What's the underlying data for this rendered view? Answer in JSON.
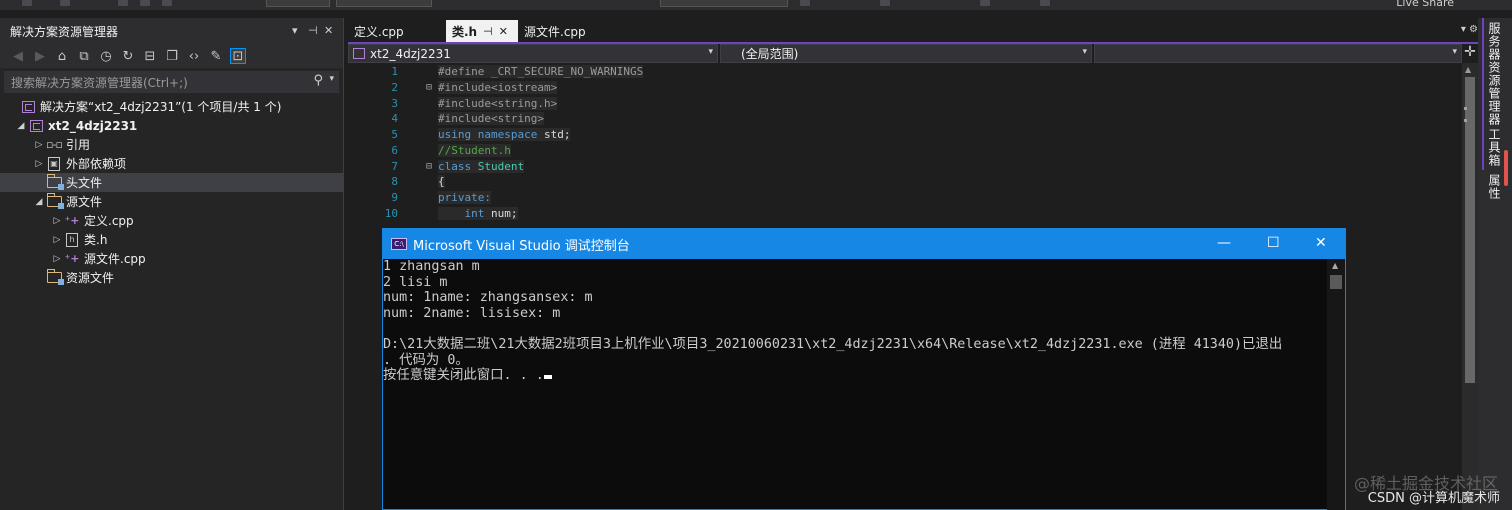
{
  "topbar": {
    "live_share": "Live Share"
  },
  "solution_explorer": {
    "title": "解决方案资源管理器",
    "controls": {
      "dropdown": "▾",
      "pin": "⊣",
      "close": "✕"
    },
    "search_placeholder": "搜索解决方案资源管理器(Ctrl+;)",
    "tree": [
      {
        "label": "解决方案“xt2_4dzj2231”(1 个项目/共 1 个)",
        "icon": "solution-icon",
        "indent": 0,
        "arrow": ""
      },
      {
        "label": "xt2_4dzj2231",
        "icon": "project-icon",
        "indent": 1,
        "arrow": "◢",
        "bold": true
      },
      {
        "label": "引用",
        "icon": "references-icon",
        "indent": 2,
        "arrow": "▷"
      },
      {
        "label": "外部依赖项",
        "icon": "external-deps-icon",
        "indent": 2,
        "arrow": "▷"
      },
      {
        "label": "头文件",
        "icon": "folder-icon",
        "indent": 2,
        "arrow": "",
        "selected": true
      },
      {
        "label": "源文件",
        "icon": "folder-icon",
        "indent": 2,
        "arrow": "◢"
      },
      {
        "label": "定义.cpp",
        "icon": "cpp-file-icon",
        "indent": 3,
        "arrow": "▷"
      },
      {
        "label": "类.h",
        "icon": "header-file-icon",
        "indent": 3,
        "arrow": "▷"
      },
      {
        "label": "源文件.cpp",
        "icon": "cpp-file-icon",
        "indent": 3,
        "arrow": "▷"
      },
      {
        "label": "资源文件",
        "icon": "folder-icon",
        "indent": 2,
        "arrow": ""
      }
    ]
  },
  "editor": {
    "tabs": [
      {
        "label": "定义.cpp",
        "active": false
      },
      {
        "label": "类.h",
        "active": true
      },
      {
        "label": "源文件.cpp",
        "active": false
      }
    ],
    "active_tab_pin": "⊣",
    "active_tab_close": "✕",
    "navbar": {
      "project": "xt2_4dzj2231",
      "scope": "(全局范围)",
      "member": ""
    },
    "code_lines": [
      {
        "n": "1",
        "fold": "",
        "tokens": [
          [
            "pp",
            "#define _CRT_SECURE_NO_WARNINGS"
          ]
        ]
      },
      {
        "n": "2",
        "fold": "⊟",
        "tokens": [
          [
            "pp",
            "#include<iostream>"
          ]
        ]
      },
      {
        "n": "3",
        "fold": "",
        "tokens": [
          [
            "pp",
            "#include<string.h>"
          ]
        ]
      },
      {
        "n": "4",
        "fold": "",
        "tokens": [
          [
            "pp",
            "#include<string>"
          ]
        ]
      },
      {
        "n": "5",
        "fold": "",
        "tokens": [
          [
            "kw",
            "using namespace "
          ],
          [
            "tx",
            "std;"
          ]
        ]
      },
      {
        "n": "6",
        "fold": "",
        "tokens": [
          [
            "cm",
            "//Student.h"
          ]
        ]
      },
      {
        "n": "7",
        "fold": "⊟",
        "tokens": [
          [
            "kw",
            "class "
          ],
          [
            "ty",
            "Student"
          ]
        ]
      },
      {
        "n": "8",
        "fold": "",
        "tokens": [
          [
            "tx",
            "{"
          ]
        ]
      },
      {
        "n": "9",
        "fold": "",
        "tokens": [
          [
            "kw",
            "private:"
          ]
        ]
      },
      {
        "n": "10",
        "fold": "",
        "tokens": [
          [
            "tx",
            "    "
          ],
          [
            "kw",
            "int "
          ],
          [
            "tx",
            "num;"
          ]
        ]
      }
    ]
  },
  "console": {
    "title": "Microsoft Visual Studio 调试控制台",
    "lines": [
      "1 zhangsan m",
      "2 lisi m",
      "num: 1name: zhangsansex: m",
      "num: 2name: lisisex: m",
      "",
      "D:\\21大数据二班\\21大数据2班项目3上机作业\\项目3_20210060231\\xt2_4dzj2231\\x64\\Release\\xt2_4dzj2231.exe (进程 41340)已退出",
      ". 代码为 0。",
      "按任意键关闭此窗口. . ."
    ]
  },
  "right_panel": {
    "tabs": [
      "服务器资源管理器",
      "工具箱",
      "属性"
    ]
  },
  "watermark": {
    "line1": "@稀土掘金技术社区",
    "line2": "CSDN @计算机魔术师"
  },
  "colors": {
    "accent": "#6f42c1",
    "console_title": "#1787e6",
    "background": "#1e1e1e"
  }
}
